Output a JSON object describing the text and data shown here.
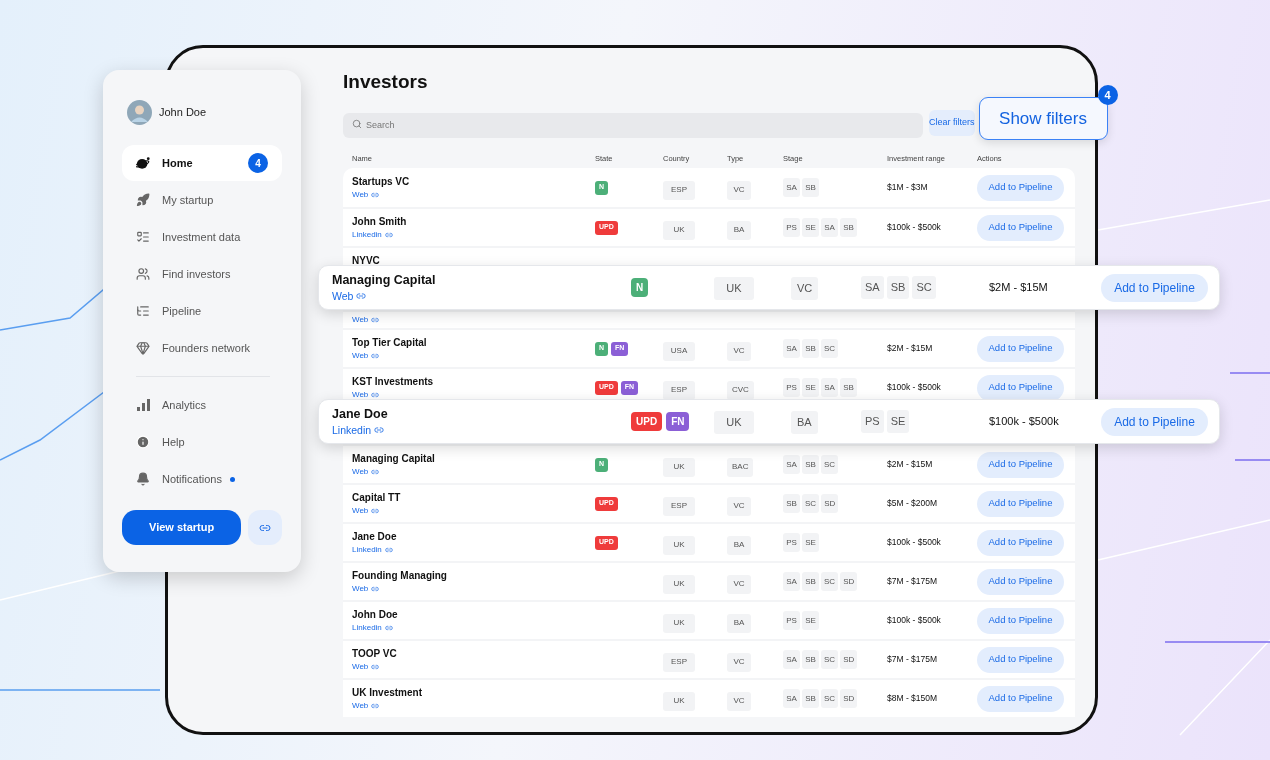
{
  "sidebar": {
    "user": {
      "name": "John Doe"
    },
    "nav_main": [
      {
        "label": "Home",
        "selected": true,
        "badge": "4"
      },
      {
        "label": "My startup",
        "selected": false
      },
      {
        "label": "Investment data",
        "selected": false
      },
      {
        "label": "Find investors",
        "selected": false
      },
      {
        "label": "Pipeline",
        "selected": false
      },
      {
        "label": "Founders network",
        "selected": false
      }
    ],
    "nav_secondary": [
      {
        "label": "Analytics",
        "selected": false,
        "dot": false
      },
      {
        "label": "Help",
        "selected": false,
        "dot": false
      },
      {
        "label": "Notifications",
        "selected": false,
        "dot": true
      }
    ],
    "primary_button": "View startup"
  },
  "page": {
    "title": "Investors",
    "search": {
      "placeholder": "Search"
    },
    "clear_filters": "Clear filters",
    "show_filters": {
      "label": "Show filters",
      "badge": "4"
    }
  },
  "table": {
    "columns": [
      "Name",
      "State",
      "Country",
      "Type",
      "Stage",
      "Investment range",
      "Actions"
    ],
    "rows": [
      {
        "kind": "row",
        "name": "Startups VC",
        "link": "Web",
        "state": [
          {
            "label": "N",
            "kind": "new"
          }
        ],
        "country": "ESP",
        "type": "VC",
        "stage": [
          "SA",
          "SB"
        ],
        "range": "$1M - $3M",
        "action": "Add to Pipeline"
      },
      {
        "kind": "row",
        "name": "John Smith",
        "link": "Linkedin",
        "state": [
          {
            "label": "UPD",
            "kind": "updated"
          }
        ],
        "country": "UK",
        "type": "BA",
        "stage": [
          "PS",
          "SE",
          "SA",
          "SB"
        ],
        "range": "$100k - $500k",
        "action": "Add to Pipeline"
      },
      {
        "kind": "row",
        "name": "NYVC"
      },
      {
        "kind": "highlight",
        "name": "Managing Capital",
        "link": "Web",
        "state": [
          {
            "label": "N",
            "kind": "new"
          }
        ],
        "country": "UK",
        "type": "VC",
        "stage": [
          "SA",
          "SB",
          "SC"
        ],
        "range": "$2M - $15M",
        "action": "Add to Pipeline"
      },
      {
        "kind": "row",
        "link": "Web"
      },
      {
        "kind": "row",
        "name": "Top Tier Capital",
        "link": "Web",
        "state": [
          {
            "label": "N",
            "kind": "new"
          },
          {
            "label": "FN",
            "kind": "fn"
          }
        ],
        "country": "USA",
        "type": "VC",
        "stage": [
          "SA",
          "SB",
          "SC"
        ],
        "range": "$2M - $15M",
        "action": "Add to Pipeline"
      },
      {
        "kind": "row",
        "name": "KST Investments",
        "link": "Web",
        "state": [
          {
            "label": "UPD",
            "kind": "updated"
          },
          {
            "label": "FN",
            "kind": "fn"
          }
        ],
        "country": "ESP",
        "type": "CVC",
        "stage": [
          "PS",
          "SE",
          "SA",
          "SB"
        ],
        "range": "$100k - $500k",
        "action": "Add to Pipeline"
      },
      {
        "kind": "highlight",
        "name": "Jane Doe",
        "link": "Linkedin",
        "state": [
          {
            "label": "UPD",
            "kind": "updated"
          },
          {
            "label": "FN",
            "kind": "fn"
          }
        ],
        "country": "UK",
        "type": "BA",
        "stage": [
          "PS",
          "SE"
        ],
        "range": "$100k - $500k",
        "action": "Add to Pipeline"
      },
      {
        "kind": "row",
        "name": "Managing Capital",
        "link": "Web",
        "state": [
          {
            "label": "N",
            "kind": "new"
          }
        ],
        "country": "UK",
        "type": "BAC",
        "stage": [
          "SA",
          "SB",
          "SC"
        ],
        "range": "$2M - $15M",
        "action": "Add to Pipeline"
      },
      {
        "kind": "row",
        "name": "Capital TT",
        "link": "Web",
        "state": [
          {
            "label": "UPD",
            "kind": "updated"
          }
        ],
        "country": "ESP",
        "type": "VC",
        "stage": [
          "SB",
          "SC",
          "SD"
        ],
        "range": "$5M - $200M",
        "action": "Add to Pipeline"
      },
      {
        "kind": "row",
        "name": "Jane Doe",
        "link": "Linkedin",
        "state": [
          {
            "label": "UPD",
            "kind": "updated"
          }
        ],
        "country": "UK",
        "type": "BA",
        "stage": [
          "PS",
          "SE"
        ],
        "range": "$100k - $500k",
        "action": "Add to Pipeline"
      },
      {
        "kind": "row",
        "name": "Founding Managing",
        "link": "Web",
        "state": [],
        "country": "UK",
        "type": "VC",
        "stage": [
          "SA",
          "SB",
          "SC",
          "SD"
        ],
        "range": "$7M - $175M",
        "action": "Add to Pipeline"
      },
      {
        "kind": "row",
        "name": "John Doe",
        "link": "Linkedin",
        "state": [],
        "country": "UK",
        "type": "BA",
        "stage": [
          "PS",
          "SE"
        ],
        "range": "$100k - $500k",
        "action": "Add to Pipeline"
      },
      {
        "kind": "row",
        "name": "TOOP VC",
        "link": "Web",
        "state": [],
        "country": "ESP",
        "type": "VC",
        "stage": [
          "SA",
          "SB",
          "SC",
          "SD"
        ],
        "range": "$7M - $175M",
        "action": "Add to Pipeline"
      },
      {
        "kind": "row",
        "name": "UK Investment",
        "link": "Web",
        "state": [],
        "country": "UK",
        "type": "VC",
        "stage": [
          "SA",
          "SB",
          "SC",
          "SD"
        ],
        "range": "$8M - $150M",
        "action": "Add to Pipeline"
      }
    ]
  }
}
